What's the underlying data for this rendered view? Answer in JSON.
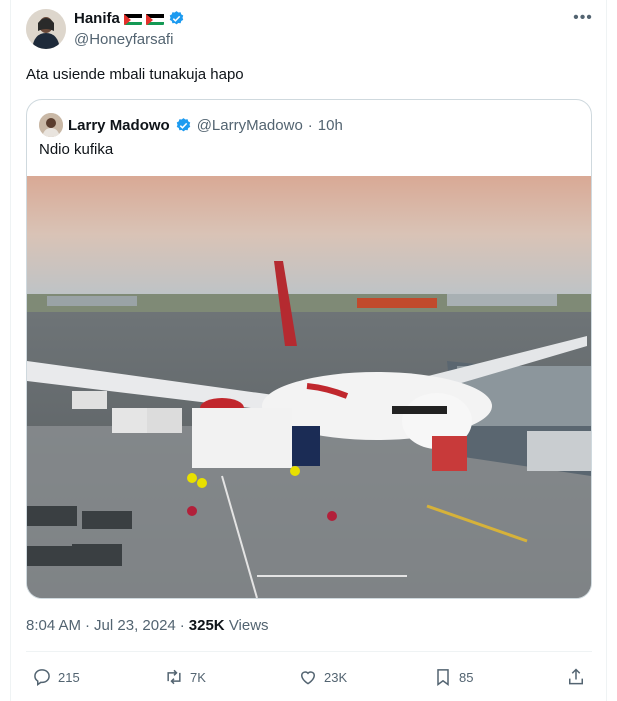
{
  "tweet": {
    "author_name": "Hanifa",
    "author_handle": "@Honeyfarsafi",
    "flags": [
      "palestine-flag",
      "palestine-flag"
    ],
    "text": "Ata usiende mbali tunakuja hapo",
    "more_icon": "ellipsis-icon"
  },
  "quote": {
    "author_name": "Larry Madowo",
    "author_handle": "@LarryMadowo",
    "separator": "·",
    "time": "10h",
    "text": "Ndio kufika"
  },
  "meta": {
    "time": "8:04 AM",
    "dot": "·",
    "date": "Jul 23, 2024",
    "dot2": "·",
    "views_count": "325K",
    "views_label": "Views"
  },
  "actions": {
    "replies": "215",
    "retweets": "7K",
    "likes": "23K",
    "bookmarks": "85"
  },
  "colors": {
    "verified": "#1d9bf0",
    "muted": "#536471",
    "text": "#0f1419",
    "border": "#cfd9de"
  }
}
